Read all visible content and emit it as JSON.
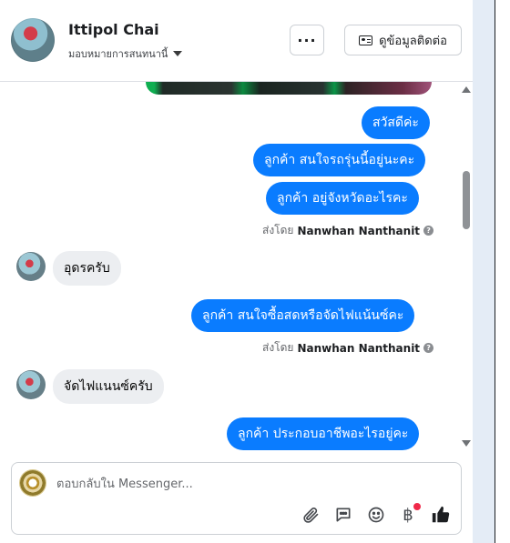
{
  "header": {
    "contact_name": "Ittipol Chai",
    "assignee_label": "มอบหมายการสนทนานี้",
    "more_label": "···",
    "contact_info_label": "ดูข้อมูลติดต่อ"
  },
  "messages": [
    {
      "id": "m1",
      "direction": "outgoing",
      "text": "สวัสดีค่ะ"
    },
    {
      "id": "m2",
      "direction": "outgoing",
      "text": "ลูกค้า สนใจรถรุ่นนี้อยู่นะคะ"
    },
    {
      "id": "m3",
      "direction": "outgoing",
      "text": "ลูกค้า  อยู่จังหวัดอะไรคะ"
    },
    {
      "id": "m4",
      "direction": "incoming",
      "text": "อุดรครับ"
    },
    {
      "id": "m5",
      "direction": "outgoing",
      "text": "ลูกค้า สนใจซื้อสดหรือจัดไฟแน้นซ์คะ"
    },
    {
      "id": "m6",
      "direction": "incoming",
      "text": "จัดไฟแนนซ์ครับ"
    },
    {
      "id": "m7",
      "direction": "outgoing",
      "text": "ลูกค้า ประกอบอาชีพอะไรอยู่คะ"
    }
  ],
  "sent_by": {
    "prefix": "ส่งโดย",
    "sender": "Nanwhan Nanthanit",
    "info": "?"
  },
  "composer": {
    "placeholder": "ตอบกลับใน Messenger...",
    "tools": [
      "paperclip-icon",
      "chat-bubble-icon",
      "emoji-icon",
      "baht-icon",
      "thumbs-up-icon"
    ],
    "baht_symbol": "฿"
  },
  "colors": {
    "outgoing_bubble": "#0a7cff",
    "incoming_bubble": "#eceef1",
    "notification_dot": "#f02849"
  }
}
